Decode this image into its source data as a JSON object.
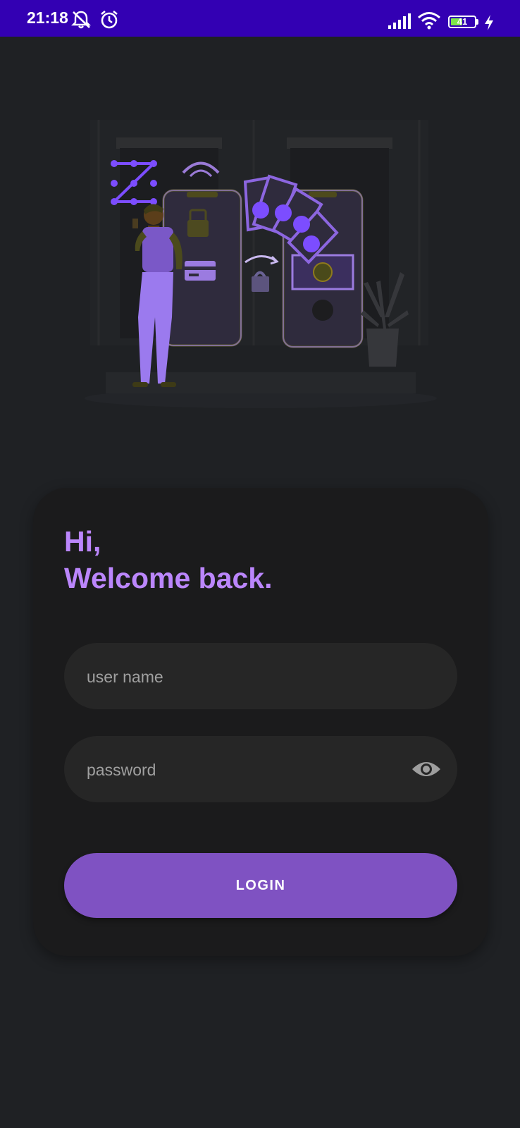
{
  "status_bar": {
    "time": "21:18",
    "icons": [
      "muted-notifications-icon",
      "alarm-icon",
      "signal-icon",
      "wifi-icon",
      "battery-icon",
      "charging-icon"
    ],
    "battery_level": "41",
    "background_color": "#3300b3"
  },
  "illustration": {
    "description_icon": "mobile-payment-illustration"
  },
  "login_card": {
    "greeting_line1": "Hi,",
    "greeting_line2": "Welcome back.",
    "username_placeholder": "user name",
    "username_value": "",
    "password_placeholder": "password",
    "password_value": "",
    "password_toggle_icon": "eye-icon",
    "login_label": "LOGIN"
  },
  "colors": {
    "accent": "#bb86fc",
    "button": "#7f52c2",
    "background": "#1f2124",
    "card": "#1b1b1c",
    "field": "#262626"
  }
}
